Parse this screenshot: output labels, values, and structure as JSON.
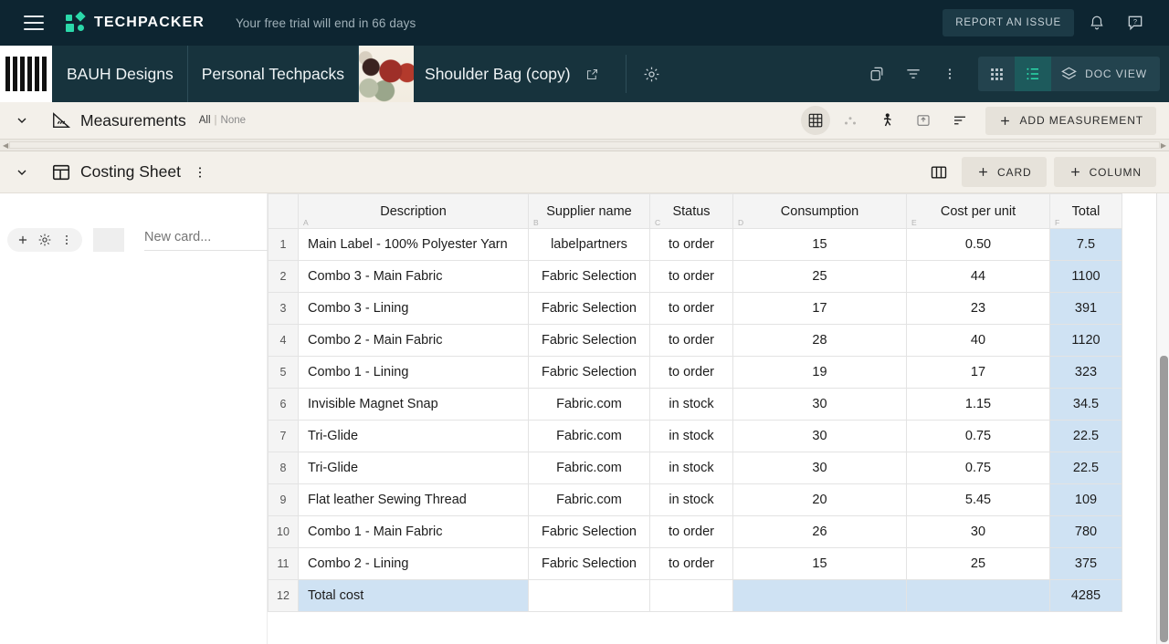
{
  "topbar": {
    "menu_icon": "hamburger-icon",
    "brand": "TECHPACKER",
    "trial_notice": "Your free trial will end in 66 days",
    "report_issue": "REPORT AN ISSUE",
    "bell_icon": "notification-bell-icon",
    "help_icon": "help-chat-icon",
    "bg_color": "#0d2531",
    "accent_color": "#2bd9aa"
  },
  "navbar": {
    "logo_alt": "BAUH",
    "breadcrumbs": [
      {
        "label": "BAUH Designs"
      },
      {
        "label": "Personal Techpacks"
      }
    ],
    "current_title": "Shoulder Bag (copy)",
    "external_link_icon": "external-link-icon",
    "settings_icon": "gear-icon",
    "copy_icon": "duplicate-pages-icon",
    "filter_icon": "filter-icon",
    "more_icon": "more-vertical-icon",
    "views": [
      {
        "name": "grid-view",
        "icon": "grid-icon",
        "active": false
      },
      {
        "name": "list-view",
        "icon": "list-icon",
        "active": true
      }
    ],
    "doc_view_label": "DOC VIEW",
    "doc_view_icon": "layers-icon",
    "bg_color": "#17333d"
  },
  "measurements": {
    "title": "Measurements",
    "icon": "ruler-triangle-icon",
    "select_all": "All",
    "separator": "|",
    "select_none": "None",
    "toolbar": [
      {
        "name": "table-grid-icon",
        "state": "selected"
      },
      {
        "name": "points-icon",
        "state": "disabled"
      },
      {
        "name": "figure-icon",
        "state": "normal"
      },
      {
        "name": "export-icon",
        "state": "normal"
      },
      {
        "name": "sort-icon",
        "state": "normal"
      }
    ],
    "add_button": "ADD MEASUREMENT",
    "add_button_icon": "plus-icon"
  },
  "costing": {
    "title": "Costing Sheet",
    "icon": "layout-panel-icon",
    "more_icon": "more-vertical-icon",
    "columns_icon": "columns-icon",
    "add_card": "CARD",
    "add_column": "COLUMN",
    "plus_icon": "plus-icon"
  },
  "left_pane": {
    "add_icon": "plus-icon",
    "settings_icon": "gear-icon",
    "more_icon": "more-vertical-icon",
    "new_card_placeholder": "New card..."
  },
  "sheet": {
    "column_letters": [
      "A",
      "B",
      "C",
      "D",
      "E",
      "F"
    ],
    "headers": [
      "Description",
      "Supplier name",
      "Status",
      "Consumption",
      "Cost per unit",
      "Total"
    ],
    "rows": [
      {
        "n": "1",
        "description": "Main Label - 100% Polyester Yarn",
        "supplier": "labelpartners",
        "status": "to order",
        "consumption": "15",
        "cost": "0.50",
        "total": "7.5"
      },
      {
        "n": "2",
        "description": "Combo 3 - Main Fabric",
        "supplier": "Fabric Selection",
        "status": "to order",
        "consumption": "25",
        "cost": "44",
        "total": "1100"
      },
      {
        "n": "3",
        "description": "Combo 3 - Lining",
        "supplier": "Fabric Selection",
        "status": "to order",
        "consumption": "17",
        "cost": "23",
        "total": "391"
      },
      {
        "n": "4",
        "description": "Combo 2 - Main Fabric",
        "supplier": "Fabric Selection",
        "status": "to order",
        "consumption": "28",
        "cost": "40",
        "total": "1120"
      },
      {
        "n": "5",
        "description": "Combo 1 - Lining",
        "supplier": "Fabric Selection",
        "status": "to order",
        "consumption": "19",
        "cost": "17",
        "total": "323"
      },
      {
        "n": "6",
        "description": "Invisible Magnet Snap",
        "supplier": "Fabric.com",
        "status": "in stock",
        "consumption": "30",
        "cost": "1.15",
        "total": "34.5"
      },
      {
        "n": "7",
        "description": "Tri-Glide",
        "supplier": "Fabric.com",
        "status": "in stock",
        "consumption": "30",
        "cost": "0.75",
        "total": "22.5"
      },
      {
        "n": "8",
        "description": "Tri-Glide",
        "supplier": "Fabric.com",
        "status": "in stock",
        "consumption": "30",
        "cost": "0.75",
        "total": "22.5"
      },
      {
        "n": "9",
        "description": "Flat leather Sewing Thread",
        "supplier": "Fabric.com",
        "status": "in stock",
        "consumption": "20",
        "cost": "5.45",
        "total": "109"
      },
      {
        "n": "10",
        "description": "Combo 1 - Main Fabric",
        "supplier": "Fabric Selection",
        "status": "to order",
        "consumption": "26",
        "cost": "30",
        "total": "780"
      },
      {
        "n": "11",
        "description": "Combo 2 - Lining",
        "supplier": "Fabric Selection",
        "status": "to order",
        "consumption": "15",
        "cost": "25",
        "total": "375"
      }
    ],
    "total_row": {
      "n": "12",
      "description": "Total cost",
      "supplier": "",
      "status": "",
      "consumption": "",
      "cost": "",
      "total": "4285"
    },
    "highlight_color": "#cfe2f3"
  }
}
